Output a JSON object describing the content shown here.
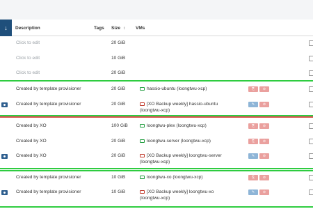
{
  "columns": {
    "description": "Description",
    "tags": "Tags",
    "size": "Size",
    "size_sort": "↕",
    "vms": "VMs"
  },
  "sort_button_icon": "↓",
  "rows": [
    {
      "description": "Click to edit",
      "placeholder": true,
      "size": "20 GiB"
    },
    {
      "description": "Click to edit",
      "placeholder": true,
      "size": "10 GiB"
    },
    {
      "description": "Click to edit",
      "placeholder": true,
      "size": "20 GiB"
    },
    {
      "description": "Created by template provisioner",
      "size": "20 GiB",
      "vm_name": "hassio-ubuntu (loongtwu-xcp)",
      "vm_state": "running"
    },
    {
      "description": "Created by template provisioner",
      "size": "20 GiB",
      "vm_name": "[XO Backup weekly] hassio-ubuntu",
      "vm_host": "(loongtwu-xcp)",
      "vm_state": "halted",
      "snapshot": true
    },
    {
      "description": "Created by XO",
      "size": "100 GiB",
      "vm_name": "loongtwu-plex (loongtwu-xcp)",
      "vm_state": "running"
    },
    {
      "description": "Created by XO",
      "size": "20 GiB",
      "vm_name": "loongtwu-server (loongtwu-xcp)",
      "vm_state": "running"
    },
    {
      "description": "Created by XO",
      "size": "20 GiB",
      "vm_name": "[XO Backup weekly] loongtwu-server",
      "vm_host": "(loongtwu-xcp)",
      "vm_state": "halted",
      "snapshot": true
    },
    {
      "description": "Created by template provisioner",
      "size": "10 GiB",
      "vm_name": "loongtwu-xo (loongtwu-xcp)",
      "vm_state": "running"
    },
    {
      "description": "Created by template provisioner",
      "size": "10 GiB",
      "vm_name": "[XO Backup weekly] loongtwu-xo",
      "vm_host": "(loongtwu-xcp)",
      "vm_state": "halted",
      "snapshot": true
    }
  ],
  "colors": {
    "header_button": "#1f4f7b",
    "highlight_green": "#2ecc40",
    "highlight_red": "#d9534f"
  }
}
